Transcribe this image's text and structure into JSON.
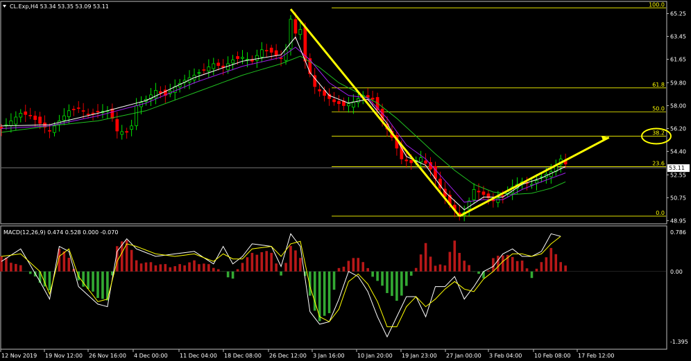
{
  "main_title": "CL.Exp,H4  53.34 53.35 53.09 53.11",
  "macd_title": "MACD(12,26,9) 0.474 0.528 0.000 -0.070",
  "current_price": "53.11",
  "colors": {
    "background": "#000000",
    "grid_border": "#c0c0c0",
    "bull_candle": "#00ff00",
    "bear_candle": "#ff0000",
    "ma_fast": "#ffffff",
    "ma_mid": "#a020f0",
    "ma_slow": "#20c020",
    "fib": "#ffff00",
    "hist_pos": "#b81818",
    "hist_neg": "#33aa33",
    "macd_line": "#ffffff",
    "signal_line": "#ffff00"
  },
  "chart_data": [
    {
      "type": "line",
      "name": "CL.Exp H4 price",
      "x_ticks": [
        "12 Nov 2019",
        "19 Nov 12:00",
        "26 Nov 16:00",
        "4 Dec 00:00",
        "11 Dec 04:00",
        "18 Dec 08:00",
        "26 Dec 12:00",
        "3 Jan 16:00",
        "10 Jan 20:00",
        "19 Jan 23:00",
        "27 Jan 00:00",
        "3 Feb 04:00",
        "10 Feb 08:00",
        "17 Feb 12:00"
      ],
      "y_ticks": [
        "65.25",
        "63.45",
        "61.65",
        "59.80",
        "58.00",
        "56.20",
        "54.40",
        "52.55",
        "50.75",
        "48.95"
      ],
      "ylim": [
        48.75,
        66.1
      ],
      "close_path": [
        [
          0,
          56.2
        ],
        [
          2,
          56.8
        ],
        [
          4,
          57.4
        ],
        [
          6,
          57.2
        ],
        [
          8,
          56.6
        ],
        [
          10,
          56.0
        ],
        [
          12,
          56.8
        ],
        [
          14,
          57.6
        ],
        [
          16,
          57.8
        ],
        [
          18,
          57.3
        ],
        [
          20,
          57.5
        ],
        [
          22,
          57.6
        ],
        [
          23,
          57.0
        ],
        [
          24,
          56.0
        ],
        [
          26,
          55.9
        ],
        [
          27,
          56.4
        ],
        [
          28,
          58.0
        ],
        [
          30,
          58.5
        ],
        [
          32,
          59.2
        ],
        [
          34,
          58.8
        ],
        [
          36,
          59.5
        ],
        [
          38,
          60.0
        ],
        [
          40,
          60.4
        ],
        [
          42,
          60.8
        ],
        [
          44,
          61.3
        ],
        [
          46,
          61.0
        ],
        [
          48,
          61.6
        ],
        [
          50,
          61.8
        ],
        [
          52,
          61.5
        ],
        [
          54,
          62.4
        ],
        [
          56,
          62.2
        ],
        [
          58,
          61.7
        ],
        [
          59,
          62.4
        ],
        [
          60,
          64.8
        ],
        [
          61,
          63.7
        ],
        [
          62,
          64.0
        ],
        [
          63,
          61.5
        ],
        [
          65,
          59.5
        ],
        [
          67,
          58.8
        ],
        [
          69,
          58.3
        ],
        [
          71,
          58.0
        ],
        [
          73,
          58.3
        ],
        [
          75,
          58.8
        ],
        [
          77,
          58.5
        ],
        [
          79,
          56.8
        ],
        [
          81,
          55.5
        ],
        [
          83,
          53.8
        ],
        [
          85,
          53.5
        ],
        [
          87,
          53.9
        ],
        [
          89,
          53.0
        ],
        [
          91,
          51.5
        ],
        [
          93,
          50.2
        ],
        [
          95,
          49.4
        ],
        [
          96,
          49.6
        ],
        [
          97,
          50.5
        ],
        [
          98,
          51.4
        ],
        [
          100,
          51.0
        ],
        [
          102,
          50.5
        ],
        [
          104,
          50.9
        ],
        [
          106,
          51.6
        ],
        [
          108,
          52.0
        ],
        [
          110,
          51.8
        ],
        [
          112,
          52.4
        ],
        [
          114,
          52.8
        ],
        [
          116,
          53.8
        ],
        [
          117,
          53.4
        ]
      ],
      "ma_fast": [
        [
          0,
          56.4
        ],
        [
          10,
          56.5
        ],
        [
          20,
          57.4
        ],
        [
          30,
          58.4
        ],
        [
          40,
          60.2
        ],
        [
          50,
          61.5
        ],
        [
          58,
          62.0
        ],
        [
          61,
          63.4
        ],
        [
          64,
          60.6
        ],
        [
          68,
          58.8
        ],
        [
          72,
          58.2
        ],
        [
          76,
          58.5
        ],
        [
          80,
          56.6
        ],
        [
          84,
          54.0
        ],
        [
          88,
          53.3
        ],
        [
          92,
          51.2
        ],
        [
          96,
          49.8
        ],
        [
          100,
          50.8
        ],
        [
          104,
          50.8
        ],
        [
          108,
          51.8
        ],
        [
          112,
          52.3
        ],
        [
          117,
          53.2
        ]
      ],
      "ma_mid": [
        [
          0,
          56.2
        ],
        [
          10,
          56.4
        ],
        [
          20,
          57.2
        ],
        [
          30,
          58.2
        ],
        [
          40,
          59.8
        ],
        [
          50,
          61.1
        ],
        [
          58,
          61.8
        ],
        [
          61,
          62.6
        ],
        [
          64,
          61.6
        ],
        [
          68,
          59.8
        ],
        [
          72,
          58.8
        ],
        [
          76,
          58.6
        ],
        [
          80,
          57.0
        ],
        [
          84,
          54.9
        ],
        [
          88,
          53.8
        ],
        [
          92,
          52.1
        ],
        [
          96,
          50.4
        ],
        [
          100,
          50.6
        ],
        [
          104,
          50.6
        ],
        [
          108,
          51.4
        ],
        [
          112,
          52.0
        ],
        [
          117,
          52.7
        ]
      ],
      "ma_slow": [
        [
          0,
          55.9
        ],
        [
          10,
          56.4
        ],
        [
          20,
          56.8
        ],
        [
          30,
          57.6
        ],
        [
          40,
          59.0
        ],
        [
          50,
          60.4
        ],
        [
          58,
          61.3
        ],
        [
          62,
          61.9
        ],
        [
          66,
          61.0
        ],
        [
          70,
          59.8
        ],
        [
          74,
          59.0
        ],
        [
          78,
          58.2
        ],
        [
          82,
          57.0
        ],
        [
          86,
          55.6
        ],
        [
          90,
          54.2
        ],
        [
          94,
          52.9
        ],
        [
          98,
          51.8
        ],
        [
          102,
          51.2
        ],
        [
          106,
          51.0
        ],
        [
          110,
          51.1
        ],
        [
          114,
          51.5
        ],
        [
          117,
          52.0
        ]
      ],
      "fibonacci": [
        {
          "level": "100.0",
          "price": 65.7
        },
        {
          "level": "61.8",
          "price": 59.4
        },
        {
          "level": "50.0",
          "price": 57.5
        },
        {
          "level": "38.2",
          "price": 55.6
        },
        {
          "level": "23.6",
          "price": 53.2
        },
        {
          "level": "0.0",
          "price": 49.3
        }
      ],
      "trend_lines": [
        {
          "from": [
            60,
            65.6
          ],
          "to": [
            95,
            49.3
          ]
        },
        {
          "from": [
            95,
            49.3
          ],
          "to": [
            126,
            55.5
          ]
        }
      ]
    },
    {
      "type": "bar",
      "name": "MACD(12,26,9)",
      "y_ticks": [
        "0.786",
        "0.00",
        "-1.395"
      ],
      "ylim": [
        -1.52,
        0.88
      ],
      "histogram": [
        [
          0,
          0.3
        ],
        [
          4,
          0.1
        ],
        [
          8,
          -0.2
        ],
        [
          10,
          -0.4
        ],
        [
          12,
          0.45
        ],
        [
          14,
          0.3
        ],
        [
          16,
          -0.2
        ],
        [
          20,
          -0.5
        ],
        [
          22,
          -0.6
        ],
        [
          24,
          0.5
        ],
        [
          26,
          0.65
        ],
        [
          28,
          0.2
        ],
        [
          32,
          0.15
        ],
        [
          36,
          0.1
        ],
        [
          40,
          0.2
        ],
        [
          44,
          0.1
        ],
        [
          48,
          -0.15
        ],
        [
          50,
          0.2
        ],
        [
          52,
          0.35
        ],
        [
          56,
          0.4
        ],
        [
          58,
          -0.1
        ],
        [
          60,
          0.5
        ],
        [
          62,
          0.3
        ],
        [
          64,
          -0.5
        ],
        [
          66,
          -1.0
        ],
        [
          68,
          -0.8
        ],
        [
          70,
          0.05
        ],
        [
          72,
          0.2
        ],
        [
          74,
          0.3
        ],
        [
          78,
          -0.2
        ],
        [
          80,
          -0.4
        ],
        [
          82,
          -0.6
        ],
        [
          84,
          -0.3
        ],
        [
          86,
          0.1
        ],
        [
          88,
          0.55
        ],
        [
          90,
          0.1
        ],
        [
          92,
          0.15
        ],
        [
          94,
          0.6
        ],
        [
          96,
          0.2
        ],
        [
          100,
          -0.15
        ],
        [
          102,
          0.25
        ],
        [
          104,
          0.35
        ],
        [
          108,
          0.2
        ],
        [
          110,
          -0.1
        ],
        [
          114,
          0.45
        ],
        [
          117,
          0.1
        ]
      ],
      "macd_line": [
        [
          0,
          0.2
        ],
        [
          4,
          0.45
        ],
        [
          8,
          -0.2
        ],
        [
          10,
          -0.55
        ],
        [
          12,
          0.5
        ],
        [
          14,
          0.4
        ],
        [
          16,
          -0.3
        ],
        [
          20,
          -0.65
        ],
        [
          22,
          -0.7
        ],
        [
          24,
          0.4
        ],
        [
          26,
          0.65
        ],
        [
          28,
          0.45
        ],
        [
          32,
          0.3
        ],
        [
          36,
          0.35
        ],
        [
          40,
          0.4
        ],
        [
          44,
          0.15
        ],
        [
          46,
          0.5
        ],
        [
          48,
          0.15
        ],
        [
          50,
          0.3
        ],
        [
          52,
          0.55
        ],
        [
          56,
          0.5
        ],
        [
          58,
          0.1
        ],
        [
          60,
          0.75
        ],
        [
          62,
          0.5
        ],
        [
          64,
          -0.8
        ],
        [
          66,
          -1.05
        ],
        [
          68,
          -1.0
        ],
        [
          70,
          -0.55
        ],
        [
          72,
          0.0
        ],
        [
          74,
          -0.1
        ],
        [
          76,
          -0.4
        ],
        [
          78,
          -0.9
        ],
        [
          80,
          -1.3
        ],
        [
          82,
          -0.9
        ],
        [
          84,
          -0.5
        ],
        [
          86,
          -0.5
        ],
        [
          88,
          -0.9
        ],
        [
          90,
          -0.3
        ],
        [
          92,
          -0.3
        ],
        [
          94,
          -0.1
        ],
        [
          96,
          -0.55
        ],
        [
          98,
          -0.3
        ],
        [
          100,
          0.0
        ],
        [
          102,
          0.1
        ],
        [
          104,
          0.35
        ],
        [
          106,
          0.45
        ],
        [
          108,
          0.3
        ],
        [
          110,
          0.3
        ],
        [
          112,
          0.4
        ],
        [
          114,
          0.75
        ],
        [
          116,
          0.7
        ]
      ],
      "signal_line": [
        [
          0,
          0.3
        ],
        [
          4,
          0.35
        ],
        [
          8,
          0.0
        ],
        [
          10,
          -0.45
        ],
        [
          12,
          0.3
        ],
        [
          14,
          0.45
        ],
        [
          16,
          -0.1
        ],
        [
          20,
          -0.6
        ],
        [
          22,
          -0.55
        ],
        [
          24,
          0.2
        ],
        [
          26,
          0.55
        ],
        [
          28,
          0.5
        ],
        [
          32,
          0.35
        ],
        [
          36,
          0.3
        ],
        [
          40,
          0.35
        ],
        [
          44,
          0.2
        ],
        [
          46,
          0.35
        ],
        [
          48,
          0.25
        ],
        [
          50,
          0.25
        ],
        [
          52,
          0.45
        ],
        [
          56,
          0.5
        ],
        [
          58,
          0.3
        ],
        [
          60,
          0.55
        ],
        [
          62,
          0.6
        ],
        [
          64,
          -0.3
        ],
        [
          66,
          -0.9
        ],
        [
          68,
          -1.0
        ],
        [
          70,
          -0.75
        ],
        [
          72,
          -0.2
        ],
        [
          74,
          -0.05
        ],
        [
          76,
          -0.25
        ],
        [
          78,
          -0.6
        ],
        [
          80,
          -1.1
        ],
        [
          82,
          -1.1
        ],
        [
          84,
          -0.7
        ],
        [
          86,
          -0.5
        ],
        [
          88,
          -0.7
        ],
        [
          90,
          -0.55
        ],
        [
          92,
          -0.35
        ],
        [
          94,
          -0.2
        ],
        [
          96,
          -0.35
        ],
        [
          98,
          -0.4
        ],
        [
          100,
          -0.15
        ],
        [
          102,
          0.0
        ],
        [
          104,
          0.2
        ],
        [
          106,
          0.35
        ],
        [
          108,
          0.35
        ],
        [
          110,
          0.3
        ],
        [
          112,
          0.35
        ],
        [
          114,
          0.55
        ],
        [
          116,
          0.7
        ]
      ]
    }
  ]
}
